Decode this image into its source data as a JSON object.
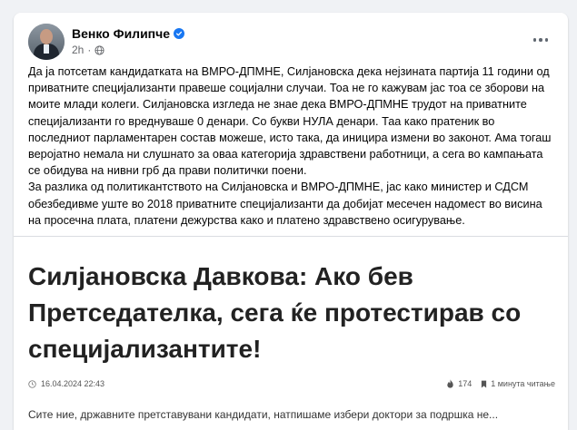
{
  "post": {
    "author_name": "Венко Филипче",
    "timestamp": "2h",
    "dot_separator": "·",
    "body_paragraphs": [
      "Да ја потсетам кандидатката на ВМРО-ДПМНЕ, Силјановска дека нејзината партија 11 години од приватните специјализанти правеше социјални случаи. Тоа не го кажувам јас тоа се зборови на моите млади колеги. Силјановска изгледа не знае дека ВМРО-ДПМНЕ трудот на приватните специјализанти го вреднуваше 0 денари. Со букви НУЛА денари. Таа како пратеник во последниот парламентарен состав можеше, исто така, да иницира измени во законот. Ама тогаш веројатно немала ни слушнато за оваа категорија здравствени работници, а сега во кампањата се обидува на нивни грб да прави политички поени.",
      "За разлика од политикантството на Силјановска и ВМРО-ДПМНЕ, јас како министер и СДСМ обезбедивме уште во 2018 приватните специјализанти да добијат месечен надомест во висина на просечна плата, платени дежурства како и платено здравствено осигурување."
    ]
  },
  "article": {
    "title": "Силјановска Давкова: Ако бев Претседателка, сега ќе протестирав со специјализантите!",
    "date": "16.04.2024 22:43",
    "views": "174",
    "read_time": "1 минута читање",
    "cut_off_text": "Сите ние, државните претставувани кандидати, натпишаме избери доктори за подршка не..."
  },
  "icons": {
    "verified": "verified-badge-icon",
    "privacy": "globe-icon",
    "more": "more-options-icon",
    "clock": "clock-icon",
    "views": "fire-icon",
    "read_time": "bookmark-icon"
  },
  "colors": {
    "background": "#f0f2f5",
    "verified": "#1877f2",
    "secondary_text": "#65676b"
  }
}
